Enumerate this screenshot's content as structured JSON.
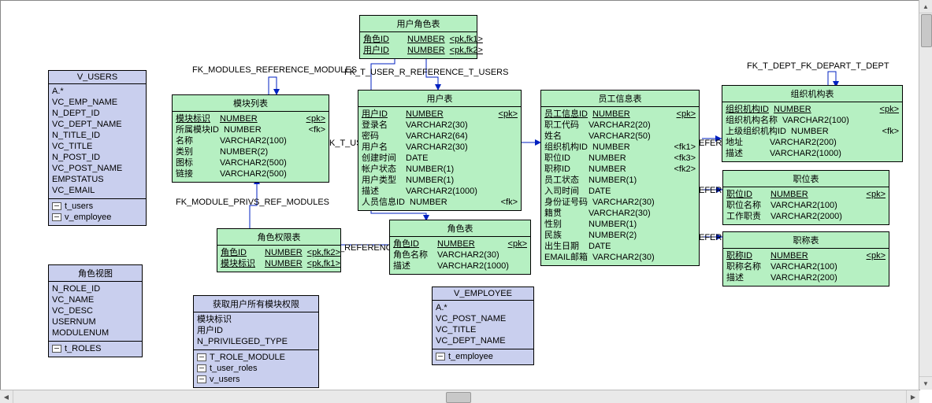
{
  "fk_labels": {
    "modules_ref_modules": "FK_MODULES_REFERENCE_MODULES",
    "t_user_r_ref_t_users": "FK_T_USER_R_REFERENCE_T_USERS",
    "t_dept_fk_depart_t_dept": "FK_T_DEPT_FK_DEPART_T_DEPT",
    "module_privs_ref_modules": "FK_MODULE_PRIVS_REF_MODULES",
    "reference_frag": "_REFERENCE",
    "k_t_us_frag": "K_T_US",
    "efer_frag1": "EFER",
    "efer_frag2": "EFER",
    "efer_frag3": "EFER"
  },
  "entities": {
    "v_users": {
      "title": "V_USERS",
      "cols": [
        {
          "n": "A.*"
        },
        {
          "n": "VC_EMP_NAME"
        },
        {
          "n": "N_DEPT_ID"
        },
        {
          "n": "VC_DEPT_NAME"
        },
        {
          "n": "N_TITLE_ID"
        },
        {
          "n": "VC_TITLE"
        },
        {
          "n": "N_POST_ID"
        },
        {
          "n": "VC_POST_NAME"
        },
        {
          "n": "EMPSTATUS"
        },
        {
          "n": "VC_EMAIL"
        }
      ],
      "refs": [
        {
          "n": "t_users"
        },
        {
          "n": "v_employee"
        }
      ]
    },
    "role_view": {
      "title": "角色视图",
      "cols": [
        {
          "n": "N_ROLE_ID"
        },
        {
          "n": "VC_NAME"
        },
        {
          "n": "VC_DESC"
        },
        {
          "n": "USERNUM"
        },
        {
          "n": "MODULENUM"
        }
      ],
      "refs": [
        {
          "n": "t_ROLES"
        }
      ]
    },
    "user_role": {
      "title": "用户角色表",
      "cols": [
        {
          "n": "角色ID",
          "t": "NUMBER",
          "k": "<pk,fk1>",
          "pk": true
        },
        {
          "n": "用户ID",
          "t": "NUMBER",
          "k": "<pk,fk2>",
          "pk": true
        }
      ]
    },
    "modules": {
      "title": "模块列表",
      "cols": [
        {
          "n": "模块标识",
          "t": "NUMBER",
          "k": "<pk>",
          "pk": true
        },
        {
          "n": "所属模块ID",
          "t": "NUMBER",
          "k": "<fk>"
        },
        {
          "n": "名称",
          "t": "VARCHAR2(100)"
        },
        {
          "n": "类别",
          "t": "NUMBER(2)"
        },
        {
          "n": "图标",
          "t": "VARCHAR2(500)"
        },
        {
          "n": "链接",
          "t": "VARCHAR2(500)"
        }
      ]
    },
    "users": {
      "title": "用户表",
      "cols": [
        {
          "n": "用户ID",
          "t": "NUMBER",
          "k": "<pk>",
          "pk": true
        },
        {
          "n": "登录名",
          "t": "VARCHAR2(30)"
        },
        {
          "n": "密码",
          "t": "VARCHAR2(64)"
        },
        {
          "n": "用户名",
          "t": "VARCHAR2(30)"
        },
        {
          "n": "创建时间",
          "t": "DATE"
        },
        {
          "n": "帐户状态",
          "t": "NUMBER(1)"
        },
        {
          "n": "用户类型",
          "t": "NUMBER(1)"
        },
        {
          "n": "描述",
          "t": "VARCHAR2(1000)"
        },
        {
          "n": "人员信息ID",
          "t": "NUMBER",
          "k": "<fk>"
        }
      ]
    },
    "role_privs": {
      "title": "角色权限表",
      "cols": [
        {
          "n": "角色ID",
          "t": "NUMBER",
          "k": "<pk,fk2>",
          "pk": true
        },
        {
          "n": "模块标识",
          "t": "NUMBER",
          "k": "<pk,fk1>",
          "pk": true
        }
      ]
    },
    "roles": {
      "title": "角色表",
      "cols": [
        {
          "n": "角色ID",
          "t": "NUMBER",
          "k": "<pk>",
          "pk": true
        },
        {
          "n": "角色名称",
          "t": "VARCHAR2(30)"
        },
        {
          "n": "描述",
          "t": "VARCHAR2(1000)"
        }
      ]
    },
    "employee": {
      "title": "员工信息表",
      "cols": [
        {
          "n": "员工信息ID",
          "t": "NUMBER",
          "k": "<pk>",
          "pk": true
        },
        {
          "n": "职工代码",
          "t": "VARCHAR2(20)"
        },
        {
          "n": "姓名",
          "t": "VARCHAR2(50)"
        },
        {
          "n": "组织机构ID",
          "t": "NUMBER",
          "k": "<fk1>"
        },
        {
          "n": "职位ID",
          "t": "NUMBER",
          "k": "<fk3>"
        },
        {
          "n": "职称ID",
          "t": "NUMBER",
          "k": "<fk2>"
        },
        {
          "n": "员工状态",
          "t": "NUMBER(1)"
        },
        {
          "n": "入司时间",
          "t": "DATE"
        },
        {
          "n": "身份证号码",
          "t": "VARCHAR2(30)"
        },
        {
          "n": "籍贯",
          "t": "VARCHAR2(30)"
        },
        {
          "n": "性别",
          "t": "NUMBER(1)"
        },
        {
          "n": "民族",
          "t": "NUMBER(2)"
        },
        {
          "n": "出生日期",
          "t": "DATE"
        },
        {
          "n": "EMAIL邮箱",
          "t": "VARCHAR2(30)"
        }
      ]
    },
    "dept": {
      "title": "组织机构表",
      "cols": [
        {
          "n": "组织机构ID",
          "t": "NUMBER",
          "k": "<pk>",
          "pk": true
        },
        {
          "n": "组织机构名称",
          "t": "VARCHAR2(100)"
        },
        {
          "n": "上级组织机构ID",
          "t": "NUMBER",
          "k": "<fk>"
        },
        {
          "n": "地址",
          "t": "VARCHAR2(200)"
        },
        {
          "n": "描述",
          "t": "VARCHAR2(1000)"
        }
      ]
    },
    "post": {
      "title": "职位表",
      "cols": [
        {
          "n": "职位ID",
          "t": "NUMBER",
          "k": "<pk>",
          "pk": true
        },
        {
          "n": "职位名称",
          "t": "VARCHAR2(100)"
        },
        {
          "n": "工作职责",
          "t": "VARCHAR2(2000)"
        }
      ]
    },
    "title_tab": {
      "title": "职称表",
      "cols": [
        {
          "n": "职称ID",
          "t": "NUMBER",
          "k": "<pk>",
          "pk": true
        },
        {
          "n": "职称名称",
          "t": "VARCHAR2(100)"
        },
        {
          "n": "描述",
          "t": "VARCHAR2(200)"
        }
      ]
    },
    "proc_privs": {
      "title": "获取用户所有模块权限",
      "cols": [
        {
          "n": "模块标识"
        },
        {
          "n": "用户ID"
        },
        {
          "n": "N_PRIVILEGED_TYPE"
        }
      ],
      "refs": [
        {
          "n": "T_ROLE_MODULE"
        },
        {
          "n": "t_user_roles"
        },
        {
          "n": "v_users"
        }
      ]
    },
    "v_employee": {
      "title": "V_EMPLOYEE",
      "cols": [
        {
          "n": "A.*"
        },
        {
          "n": "VC_POST_NAME"
        },
        {
          "n": "VC_TITLE"
        },
        {
          "n": "VC_DEPT_NAME"
        }
      ],
      "refs": [
        {
          "n": "t_employee"
        }
      ]
    }
  }
}
